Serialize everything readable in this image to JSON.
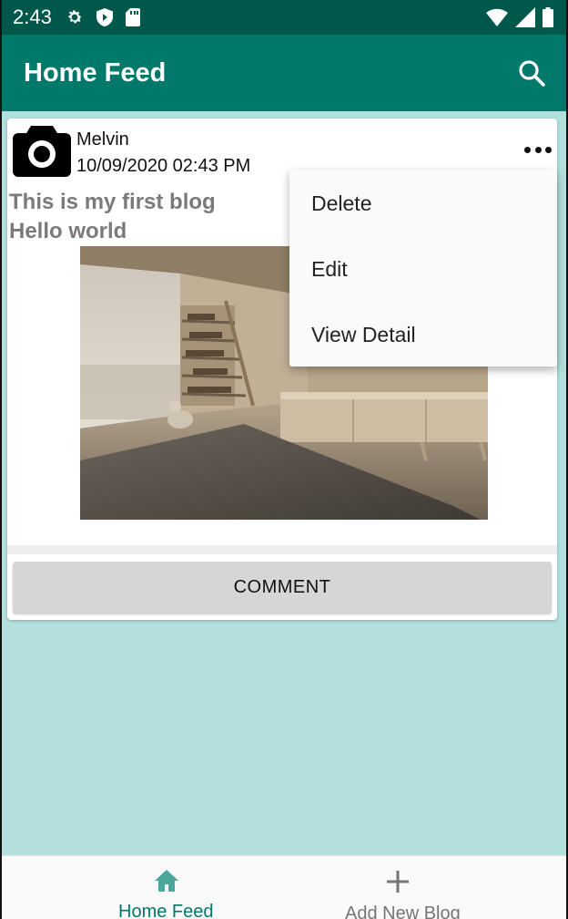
{
  "status_bar": {
    "time": "2:43",
    "icons_left": [
      "gear-icon",
      "shield-icon",
      "sd-card-icon"
    ],
    "icons_right": [
      "wifi-icon",
      "signal-icon",
      "battery-icon"
    ]
  },
  "app_bar": {
    "title": "Home Feed",
    "search_icon": "search-icon",
    "color": "#00796b"
  },
  "post": {
    "author": "Melvin",
    "date": "10/09/2020 02:43 PM",
    "title": "This is my first blog",
    "body": "Hello world",
    "avatar_icon": "camera-icon",
    "more_icon": "more-horizontal-icon",
    "comment_label": "COMMENT"
  },
  "menu": {
    "items": [
      "Delete",
      "Edit",
      "View Detail"
    ]
  },
  "bottom_nav": {
    "items": [
      {
        "label": "Home Feed",
        "icon": "home-icon",
        "active": true
      },
      {
        "label": "Add New Blog",
        "icon": "plus-icon",
        "active": false
      }
    ]
  },
  "colors": {
    "status_bar": "#00584b",
    "primary": "#00796b",
    "background": "#b3e0dc",
    "active_nav": "#00796b",
    "inactive_nav": "#757575"
  }
}
